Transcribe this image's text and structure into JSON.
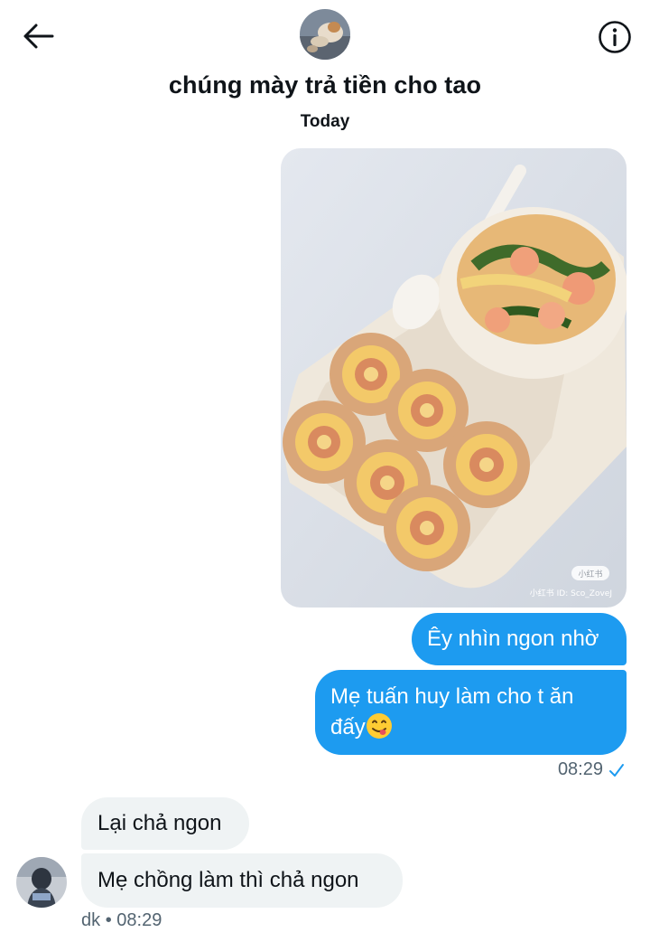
{
  "header": {
    "title": "chúng mày trả tiền cho tao",
    "back_icon": "arrow-left-icon",
    "info_icon": "info-icon",
    "group_avatar": "dog-photo"
  },
  "date_divider": "Today",
  "photo": {
    "description_icon": "food-photo",
    "watermark_badge": "小红书",
    "watermark_id": "小红书 ID: Sco_ZoveJ"
  },
  "messages": [
    {
      "direction": "out",
      "text": "Êy nhìn ngon nhờ"
    },
    {
      "direction": "out",
      "text": "Mẹ tuấn huy làm cho t ăn đấy",
      "emoji": "yum-face-emoji"
    },
    {
      "direction": "in",
      "text": "Lại chả ngon"
    },
    {
      "direction": "in",
      "text": "Mẹ chồng làm thì chả ngon"
    }
  ],
  "outgoing_meta": {
    "time": "08:29",
    "status_icon": "checkmark-icon"
  },
  "incoming_meta": {
    "sender": "dk",
    "separator": "•",
    "time": "08:29"
  },
  "colors": {
    "accent": "#1d9bf0",
    "incoming_bubble": "#eff3f4",
    "muted_text": "#536471"
  }
}
